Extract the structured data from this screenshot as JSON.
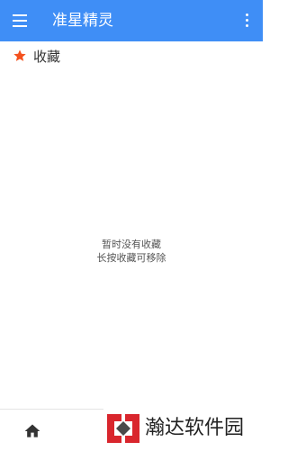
{
  "header": {
    "title": "准星精灵",
    "menu_icon": "hamburger-menu-icon",
    "more_icon": "more-vert-icon",
    "bg_color": "#3f8ef6"
  },
  "section": {
    "title": "收藏",
    "icon": "star-icon",
    "icon_color": "#f4511e"
  },
  "empty_state": {
    "line1": "暂时没有收藏",
    "line2": "长按收藏可移除"
  },
  "bottom_nav": {
    "home_icon": "home-icon"
  },
  "watermark": {
    "text": "瀚达软件园"
  }
}
